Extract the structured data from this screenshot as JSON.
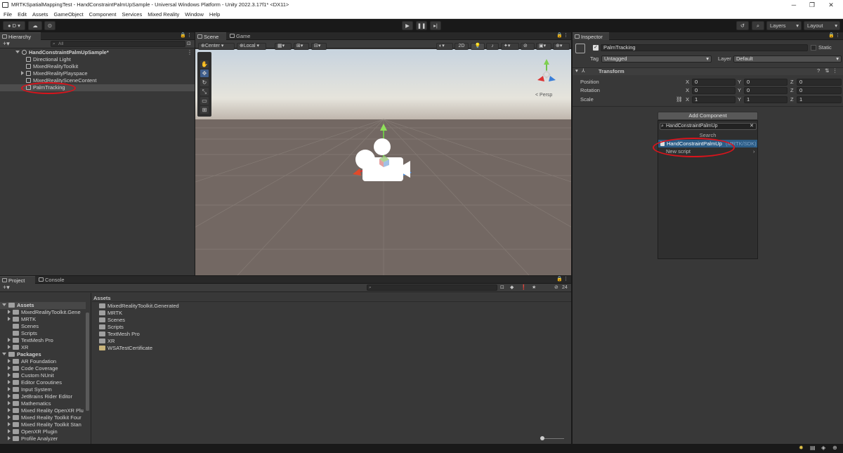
{
  "window": {
    "title": "MRTKSpatialMappingTest - HandConstraintPalmUpSample - Universal Windows Platform - Unity 2022.3.17f1* <DX11>"
  },
  "menu": [
    "File",
    "Edit",
    "Assets",
    "GameObject",
    "Component",
    "Services",
    "Mixed Reality",
    "Window",
    "Help"
  ],
  "toolbar": {
    "account": "D",
    "layers": "Layers",
    "layout": "Layout"
  },
  "hierarchy": {
    "tab": "Hierarchy",
    "search_placeholder": "All",
    "scene": "HandConstraintPalmUpSample*",
    "items": [
      "Directional Light",
      "MixedRealityToolkit",
      "MixedRealityPlayspace",
      "MixedRealitySceneContent",
      "PalmTracking"
    ]
  },
  "scene": {
    "tab_scene": "Scene",
    "tab_game": "Game",
    "pivot": "Center",
    "space": "Local",
    "mode2d": "2D",
    "persp": "< Persp"
  },
  "project": {
    "tab_project": "Project",
    "tab_console": "Console",
    "hidden_count": "24",
    "tree_assets": "Assets",
    "tree_asset_items": [
      "MixedRealityToolkit.Gene",
      "MRTK",
      "Scenes",
      "Scripts",
      "TextMesh Pro",
      "XR"
    ],
    "tree_packages": "Packages",
    "tree_package_items": [
      "AR Foundation",
      "Code Coverage",
      "Custom NUnit",
      "Editor Coroutines",
      "Input System",
      "JetBrains Rider Editor",
      "Mathematics",
      "Mixed Reality OpenXR Plu",
      "Mixed Reality Toolkit Four",
      "Mixed Reality Toolkit Stan",
      "OpenXR Plugin",
      "Profile Analyzer"
    ],
    "breadcrumb": "Assets",
    "content": [
      "MixedRealityToolkit.Generated",
      "MRTK",
      "Scenes",
      "Scripts",
      "TextMesh Pro",
      "XR",
      "WSATestCertificate"
    ]
  },
  "inspector": {
    "tab": "Inspector",
    "object_name": "PalmTracking",
    "static_label": "Static",
    "tag_label": "Tag",
    "tag_value": "Untagged",
    "layer_label": "Layer",
    "layer_value": "Default",
    "transform": "Transform",
    "position": "Position",
    "rotation": "Rotation",
    "scale": "Scale",
    "pos": {
      "x": "0",
      "y": "0",
      "z": "0"
    },
    "rot": {
      "x": "0",
      "y": "0",
      "z": "0"
    },
    "scl": {
      "x": "1",
      "y": "1",
      "z": "1"
    },
    "add_component": "Add Component",
    "ac_search": "HandConstraintPalmUp",
    "ac_header": "Search",
    "ac_result": "HandConstraintPalmUp",
    "ac_result_path": "(MRTK/SDK)",
    "ac_new_script": "New script"
  },
  "colors": {
    "highlight": "#d9141c",
    "selection": "#2c5d87"
  }
}
